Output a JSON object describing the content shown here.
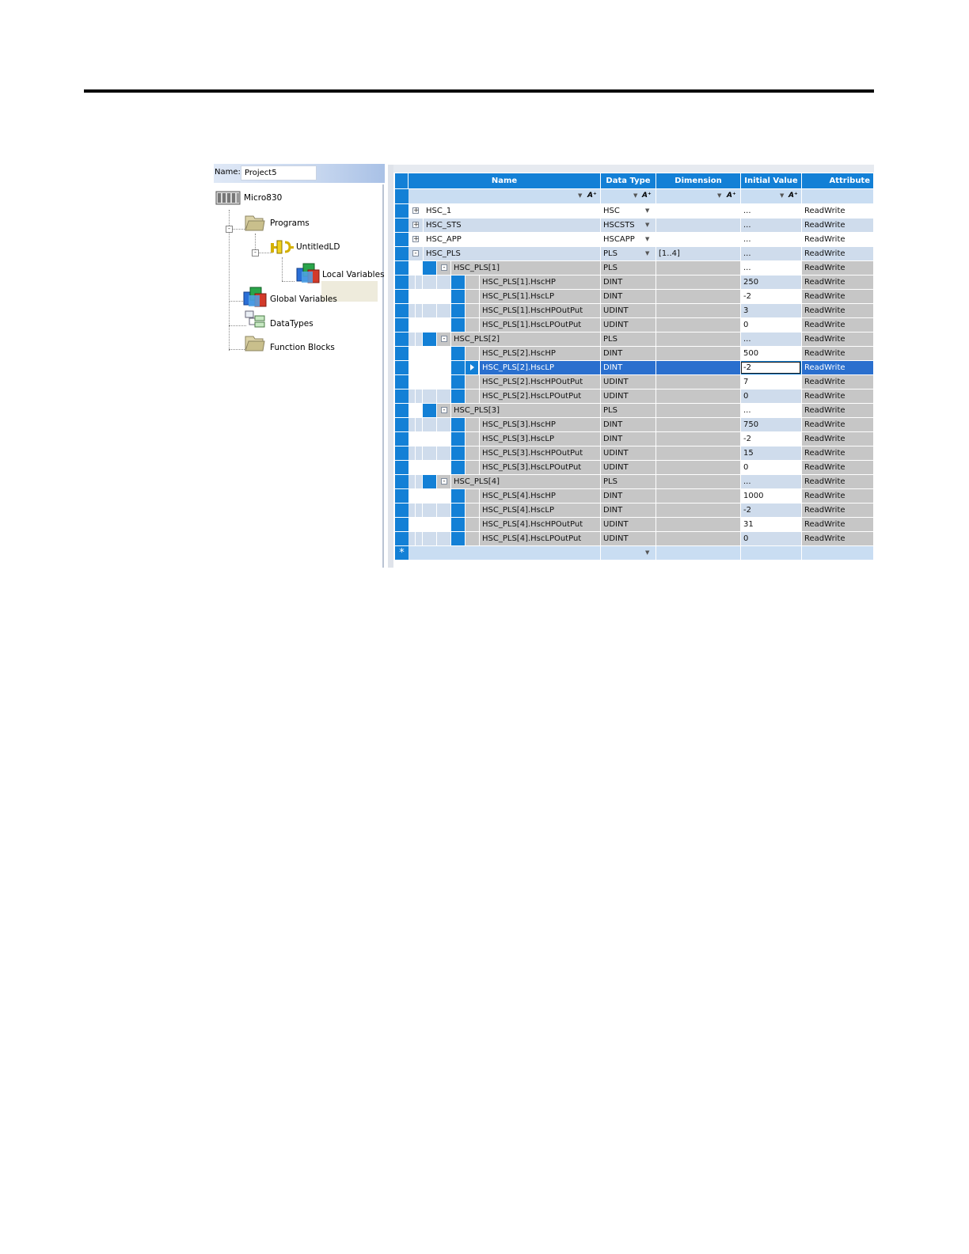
{
  "tree": {
    "name_label": "Name:",
    "name_value": "Project5",
    "nodes": [
      {
        "label": "Micro830",
        "icon": "controller-icon"
      },
      {
        "label": "Programs",
        "icon": "folder-icon"
      },
      {
        "label": "UntitledLD",
        "icon": "ladder-program-icon"
      },
      {
        "label": "Local Variables",
        "icon": "variables-icon"
      },
      {
        "label": "Global Variables",
        "icon": "variables-icon"
      },
      {
        "label": "DataTypes",
        "icon": "datatypes-icon"
      },
      {
        "label": "Function Blocks",
        "icon": "folder-icon"
      }
    ]
  },
  "grid": {
    "columns": [
      "Name",
      "Data Type",
      "Dimension",
      "Initial Value",
      "Attribute"
    ],
    "rows": [
      {
        "name": "HSC_1",
        "type": "HSC",
        "dim": "",
        "init": "...",
        "attr": "ReadWrite",
        "level": 0,
        "toggle": "+",
        "dd": true
      },
      {
        "name": "HSC_STS",
        "type": "HSCSTS",
        "dim": "",
        "init": "...",
        "attr": "ReadWrite",
        "level": 0,
        "toggle": "+",
        "dd": true
      },
      {
        "name": "HSC_APP",
        "type": "HSCAPP",
        "dim": "",
        "init": "...",
        "attr": "ReadWrite",
        "level": 0,
        "toggle": "+",
        "dd": true
      },
      {
        "name": "HSC_PLS",
        "type": "PLS",
        "dim": "[1..4]",
        "init": "...",
        "attr": "ReadWrite",
        "level": 0,
        "toggle": "-",
        "dd": true
      },
      {
        "name": "HSC_PLS[1]",
        "type": "PLS",
        "dim": "",
        "init": "...",
        "attr": "ReadWrite",
        "level": 1,
        "toggle": "-"
      },
      {
        "name": "HSC_PLS[1].HscHP",
        "type": "DINT",
        "dim": "",
        "init": "250",
        "attr": "ReadWrite",
        "level": 2
      },
      {
        "name": "HSC_PLS[1].HscLP",
        "type": "DINT",
        "dim": "",
        "init": "-2",
        "attr": "ReadWrite",
        "level": 2
      },
      {
        "name": "HSC_PLS[1].HscHPOutPut",
        "type": "UDINT",
        "dim": "",
        "init": "3",
        "attr": "ReadWrite",
        "level": 2
      },
      {
        "name": "HSC_PLS[1].HscLPOutPut",
        "type": "UDINT",
        "dim": "",
        "init": "0",
        "attr": "ReadWrite",
        "level": 2
      },
      {
        "name": "HSC_PLS[2]",
        "type": "PLS",
        "dim": "",
        "init": "...",
        "attr": "ReadWrite",
        "level": 1,
        "toggle": "-"
      },
      {
        "name": "HSC_PLS[2].HscHP",
        "type": "DINT",
        "dim": "",
        "init": "500",
        "attr": "ReadWrite",
        "level": 2
      },
      {
        "name": "HSC_PLS[2].HscLP",
        "type": "DINT",
        "dim": "",
        "init": "-2",
        "attr": "ReadWrite",
        "level": 2,
        "selected": true
      },
      {
        "name": "HSC_PLS[2].HscHPOutPut",
        "type": "UDINT",
        "dim": "",
        "init": "7",
        "attr": "ReadWrite",
        "level": 2
      },
      {
        "name": "HSC_PLS[2].HscLPOutPut",
        "type": "UDINT",
        "dim": "",
        "init": "0",
        "attr": "ReadWrite",
        "level": 2
      },
      {
        "name": "HSC_PLS[3]",
        "type": "PLS",
        "dim": "",
        "init": "...",
        "attr": "ReadWrite",
        "level": 1,
        "toggle": "-"
      },
      {
        "name": "HSC_PLS[3].HscHP",
        "type": "DINT",
        "dim": "",
        "init": "750",
        "attr": "ReadWrite",
        "level": 2
      },
      {
        "name": "HSC_PLS[3].HscLP",
        "type": "DINT",
        "dim": "",
        "init": "-2",
        "attr": "ReadWrite",
        "level": 2
      },
      {
        "name": "HSC_PLS[3].HscHPOutPut",
        "type": "UDINT",
        "dim": "",
        "init": "15",
        "attr": "ReadWrite",
        "level": 2
      },
      {
        "name": "HSC_PLS[3].HscLPOutPut",
        "type": "UDINT",
        "dim": "",
        "init": "0",
        "attr": "ReadWrite",
        "level": 2
      },
      {
        "name": "HSC_PLS[4]",
        "type": "PLS",
        "dim": "",
        "init": "...",
        "attr": "ReadWrite",
        "level": 1,
        "toggle": "-"
      },
      {
        "name": "HSC_PLS[4].HscHP",
        "type": "DINT",
        "dim": "",
        "init": "1000",
        "attr": "ReadWrite",
        "level": 2
      },
      {
        "name": "HSC_PLS[4].HscLP",
        "type": "DINT",
        "dim": "",
        "init": "-2",
        "attr": "ReadWrite",
        "level": 2
      },
      {
        "name": "HSC_PLS[4].HscHPOutPut",
        "type": "UDINT",
        "dim": "",
        "init": "31",
        "attr": "ReadWrite",
        "level": 2
      },
      {
        "name": "HSC_PLS[4].HscLPOutPut",
        "type": "UDINT",
        "dim": "",
        "init": "0",
        "attr": "ReadWrite",
        "level": 2
      }
    ],
    "new_row_marker": "*"
  },
  "colors": {
    "header": "#1380d6",
    "filter_row": "#c9ddf2",
    "row_alt": "#cfdcec",
    "greyed": "#c6c6c6",
    "selected": "#2a6fce"
  }
}
